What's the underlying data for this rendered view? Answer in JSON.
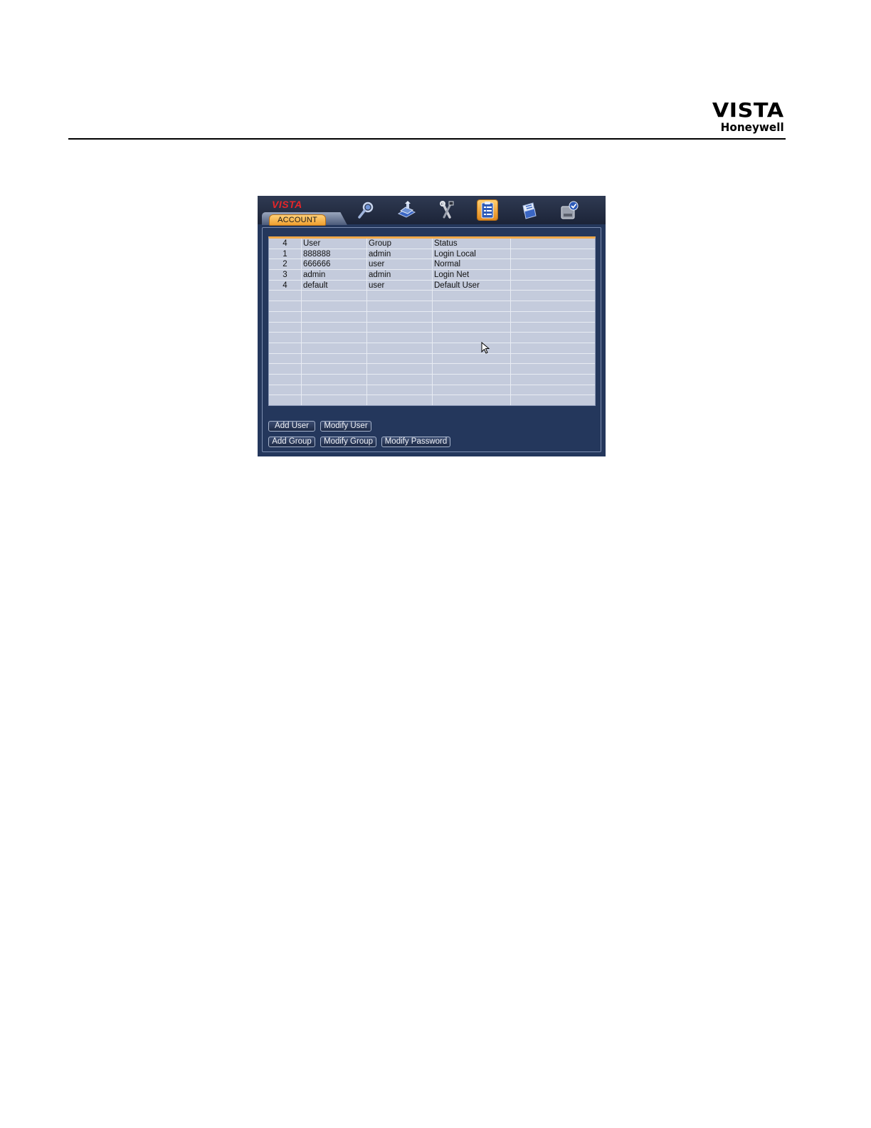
{
  "header": {
    "brand": "VISTA",
    "sub_brand": "Honeywell"
  },
  "dvr": {
    "logo": "VISTA",
    "active_tab": "ACCOUNT",
    "icons": [
      "search-icon",
      "record-icon",
      "tools-icon",
      "account-icon",
      "settings-icon",
      "disk-icon"
    ],
    "table": {
      "columns": [
        "4",
        "User",
        "Group",
        "Status",
        ""
      ],
      "rows": [
        [
          "1",
          "888888",
          "admin",
          "Login Local",
          ""
        ],
        [
          "2",
          "666666",
          "user",
          "Normal",
          ""
        ],
        [
          "3",
          "admin",
          "admin",
          "Login Net",
          ""
        ],
        [
          "4",
          "default",
          "user",
          "Default User",
          ""
        ]
      ],
      "empty_rows": 11
    },
    "buttons": {
      "add_user": "Add User",
      "modify_user": "Modify User",
      "add_group": "Add Group",
      "modify_group": "Modify Group",
      "modify_password": "Modify Password"
    }
  },
  "colors": {
    "panel_bg": "#24375c",
    "table_bg": "#c4cbdc",
    "accent": "#f1a94a",
    "logo_red": "#e5252a"
  }
}
